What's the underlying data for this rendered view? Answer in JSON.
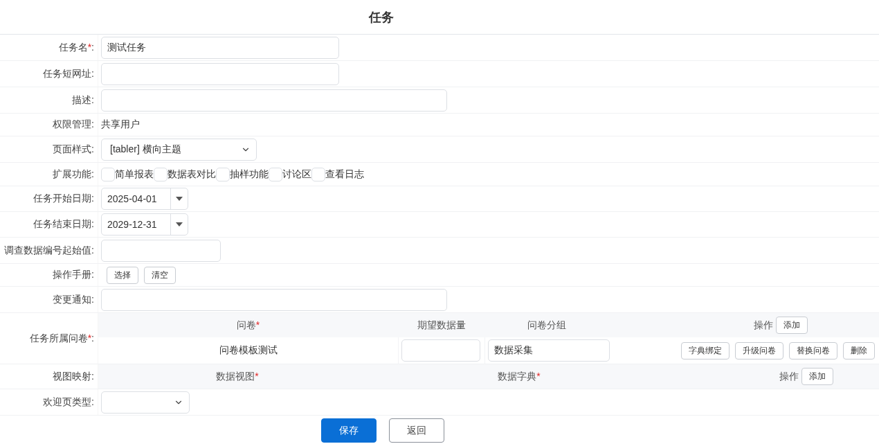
{
  "page_title": "任务",
  "fields": [
    {
      "kind": "text",
      "label": "任务名",
      "mark": "*",
      "colon": ":",
      "value": "测试任务"
    },
    {
      "kind": "text",
      "label": "任务短网址",
      "colon": ":"
    },
    {
      "kind": "text",
      "label": "描述",
      "colon": ":"
    },
    {
      "kind": "static",
      "label": "权限管理",
      "colon": ":",
      "value": "共享用户"
    },
    {
      "kind": "select",
      "label": "页面样式",
      "colon": ":",
      "value": "[tabler] 横向主题"
    },
    {
      "kind": "checkboxes",
      "label": "扩展功能",
      "colon": ":",
      "options": [
        {
          "label": "简单报表",
          "checked": false
        },
        {
          "label": "数据表对比",
          "checked": false
        },
        {
          "label": "抽样功能",
          "checked": false
        },
        {
          "label": "讨论区",
          "checked": false
        },
        {
          "label": "查看日志",
          "checked": false
        }
      ]
    },
    {
      "kind": "date",
      "label": "任务开始日期",
      "colon": ":",
      "value": "2025-04-01"
    },
    {
      "kind": "date",
      "label": "任务结束日期",
      "colon": ":",
      "value": "2029-12-31"
    },
    {
      "kind": "text",
      "label": "调查数据编号起始值",
      "colon": ":"
    },
    {
      "kind": "buttons",
      "label": "操作手册",
      "colon": ":",
      "buttons": [
        "选择",
        "清空"
      ]
    },
    {
      "kind": "text",
      "label": "变更通知",
      "colon": ":"
    },
    {
      "kind": "questionnaires",
      "label": "任务所属问卷",
      "mark": "*",
      "colon": ":",
      "columns": [
        {
          "label": "问卷",
          "mark": "*"
        },
        {
          "label": "期望数据量"
        },
        {
          "label": "问卷分组"
        },
        {
          "label": "操作"
        }
      ],
      "add_button": "添加",
      "rows": [
        {
          "questionnaire": "问卷模板测试",
          "group": "数据采集",
          "actions": [
            "字典绑定",
            "升级问卷",
            "替换问卷",
            "删除"
          ]
        }
      ]
    },
    {
      "kind": "views",
      "label": "视图映射",
      "colon": ":",
      "columns": [
        {
          "label": "数据视图",
          "mark": "*"
        },
        {
          "label": "数据字典",
          "mark": "*"
        },
        {
          "label": "操作"
        }
      ],
      "add_button": "添加"
    },
    {
      "kind": "select",
      "label": "欢迎页类型",
      "colon": ":"
    }
  ],
  "footer_buttons": [
    {
      "label": "保存",
      "primary": true
    },
    {
      "label": "返回",
      "primary": false
    }
  ]
}
